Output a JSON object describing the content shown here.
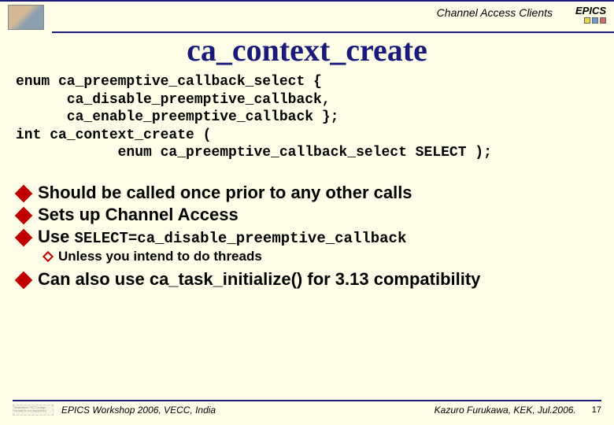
{
  "header": {
    "topic": "Channel Access Clients",
    "logo_text": "EPICS"
  },
  "title": "ca_context_create",
  "code": "enum ca_preemptive_callback_select {\n      ca_disable_preemptive_callback,\n      ca_enable_preemptive_callback };\nint ca_context_create (\n            enum ca_preemptive_callback_select SELECT );",
  "bullets": {
    "b1": "Should be called once prior to any other calls",
    "b2": "Sets up Channel Access",
    "b3_prefix": "Use ",
    "b3_code": "SELECT=ca_disable_preemptive_callback",
    "b3_sub": "Unless you intend to do threads",
    "b4": "Can also use ca_task_initialize() for 3.13 compatibility"
  },
  "footer": {
    "placeholder": "Macintosh PICT image format is not supported",
    "left": "EPICS Workshop 2006, VECC, India",
    "right": "Kazuro Furukawa, KEK, Jul.2006.",
    "page": "17"
  }
}
